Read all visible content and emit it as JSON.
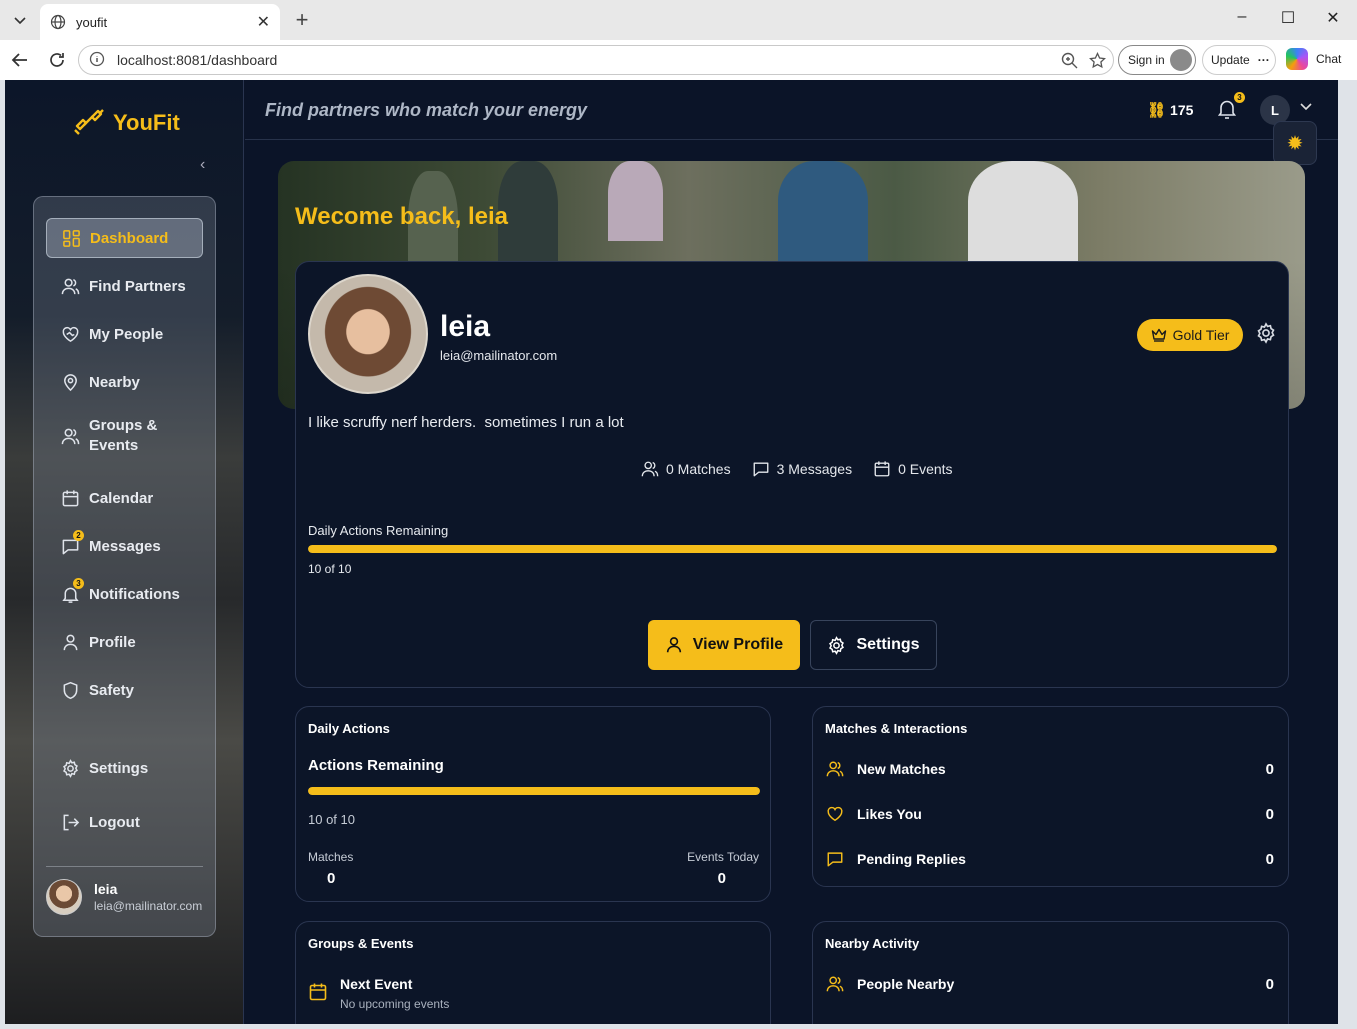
{
  "browser": {
    "tab_title": "youfit",
    "url": "localhost:8081/dashboard",
    "signin_label": "Sign in",
    "update_label": "Update",
    "chat_label": "Chat"
  },
  "app": {
    "brand": "YouFit",
    "tagline": "Find partners who match your energy",
    "coins": "175",
    "notif_count": "3",
    "avatar_initial": "L",
    "accent": "#f5bd1a",
    "bg": "#0b1428"
  },
  "sidebar": {
    "items": [
      {
        "label": "Dashboard",
        "icon": "grid-icon",
        "active": true
      },
      {
        "label": "Find Partners",
        "icon": "users-icon"
      },
      {
        "label": "My People",
        "icon": "heart-handshake-icon"
      },
      {
        "label": "Nearby",
        "icon": "map-pin-icon"
      },
      {
        "label": "Groups &\nEvents",
        "icon": "group-icon"
      },
      {
        "label": "Calendar",
        "icon": "calendar-icon"
      },
      {
        "label": "Messages",
        "icon": "message-icon",
        "badge": "2"
      },
      {
        "label": "Notifications",
        "icon": "bell-icon",
        "badge": "3"
      },
      {
        "label": "Profile",
        "icon": "user-icon"
      },
      {
        "label": "Safety",
        "icon": "shield-icon"
      },
      {
        "label": "Settings",
        "icon": "gear-icon"
      },
      {
        "label": "Logout",
        "icon": "logout-icon"
      }
    ],
    "user": {
      "name": "leia",
      "email": "leia@mailinator.com"
    }
  },
  "welcome": "Wecome back, leia",
  "profile": {
    "name": "leia",
    "email": "leia@mailinator.com",
    "tier": "Gold Tier",
    "bio": "I like scruffy nerf herders.  sometimes I run a lot",
    "stats": {
      "matches": "0 Matches",
      "messages": "3 Messages",
      "events": "0 Events"
    },
    "daily_label": "Daily Actions Remaining",
    "daily_count": "10 of 10",
    "daily_fraction": 1.0,
    "view_profile_label": "View Profile",
    "settings_label": "Settings"
  },
  "daily_actions": {
    "title": "Daily Actions",
    "subtitle": "Actions Remaining",
    "count": "10 of 10",
    "fraction": 1.0,
    "matches_label": "Matches",
    "matches_value": "0",
    "events_label": "Events Today",
    "events_value": "0"
  },
  "matches": {
    "title": "Matches & Interactions",
    "rows": [
      {
        "label": "New Matches",
        "value": "0",
        "icon": "users-icon"
      },
      {
        "label": "Likes You",
        "value": "0",
        "icon": "heart-icon"
      },
      {
        "label": "Pending Replies",
        "value": "0",
        "icon": "message-icon"
      }
    ]
  },
  "groups": {
    "title": "Groups & Events",
    "next_label": "Next Event",
    "next_value": "No upcoming events"
  },
  "nearby": {
    "title": "Nearby Activity",
    "rows": [
      {
        "label": "People Nearby",
        "value": "0",
        "icon": "users-icon"
      }
    ]
  }
}
